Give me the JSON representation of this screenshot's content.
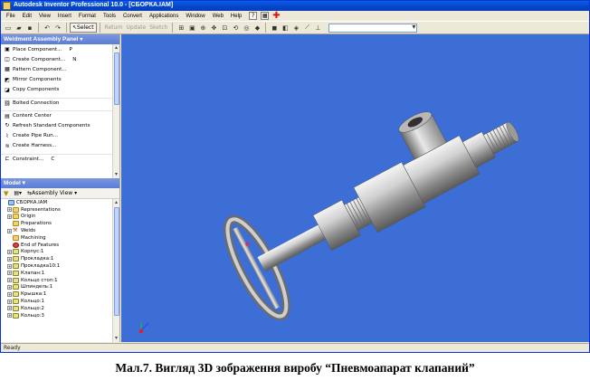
{
  "window": {
    "title": "Autodesk Inventor Professional 10.0 - [СБОРКА.IAM]"
  },
  "menu": [
    "File",
    "Edit",
    "View",
    "Insert",
    "Format",
    "Tools",
    "Convert",
    "Applications",
    "Window",
    "Web",
    "Help"
  ],
  "toolbar": {
    "select_label": "Select",
    "return_label": "Return",
    "update_label": "Update",
    "sketch_label": "Sketch"
  },
  "weldment_panel": {
    "title": "Weldment Assembly Panel",
    "commands": [
      {
        "label": "Place Component...",
        "key": "P"
      },
      {
        "label": "Create Component...",
        "key": "N"
      },
      {
        "label": "Pattern Component...",
        "key": ""
      },
      {
        "label": "Mirror Components",
        "key": ""
      },
      {
        "label": "Copy Components",
        "key": ""
      },
      {
        "label": "Bolted Connection",
        "key": ""
      },
      {
        "label": "Content Center",
        "key": ""
      },
      {
        "label": "Refresh Standard Components",
        "key": ""
      },
      {
        "label": "Create Pipe Run...",
        "key": ""
      },
      {
        "label": "Create Harness...",
        "key": ""
      },
      {
        "label": "Constraint...",
        "key": "C"
      }
    ]
  },
  "model_panel": {
    "title": "Model",
    "view_label": "Assembly View",
    "tree": [
      {
        "label": "СБОРКА.IAM",
        "icon": "asm",
        "indent": 0,
        "expand": ""
      },
      {
        "label": "Representations",
        "icon": "folder",
        "indent": 1,
        "expand": "+"
      },
      {
        "label": "Origin",
        "icon": "folder",
        "indent": 1,
        "expand": "+"
      },
      {
        "label": "Preparations",
        "icon": "folder",
        "indent": 1,
        "expand": ""
      },
      {
        "label": "Welds",
        "icon": "weld",
        "indent": 1,
        "expand": "+"
      },
      {
        "label": "Machining",
        "icon": "folder",
        "indent": 1,
        "expand": ""
      },
      {
        "label": "End of Features",
        "icon": "red",
        "indent": 1,
        "expand": ""
      },
      {
        "label": "Корпус:1",
        "icon": "part",
        "indent": 1,
        "expand": "+"
      },
      {
        "label": "Прокладка:1",
        "icon": "part",
        "indent": 1,
        "expand": "+"
      },
      {
        "label": "Прокладка10:1",
        "icon": "part",
        "indent": 1,
        "expand": "+"
      },
      {
        "label": "Клапан:1",
        "icon": "part",
        "indent": 1,
        "expand": "+"
      },
      {
        "label": "Кольцо стоп:1",
        "icon": "part",
        "indent": 1,
        "expand": "+"
      },
      {
        "label": "Шпиндель:1",
        "icon": "part",
        "indent": 1,
        "expand": "+"
      },
      {
        "label": "Крышка:1",
        "icon": "part",
        "indent": 1,
        "expand": "+"
      },
      {
        "label": "Кольцо:1",
        "icon": "part",
        "indent": 1,
        "expand": "+"
      },
      {
        "label": "Кольцо:2",
        "icon": "part",
        "indent": 1,
        "expand": "+"
      },
      {
        "label": "Кольцо:3",
        "icon": "part",
        "indent": 1,
        "expand": "+"
      }
    ]
  },
  "status": {
    "text": "Ready"
  },
  "caption": "Мал.7. Вигляд 3D зображення виробу “Пневмоапарат клапаний”",
  "colors": {
    "viewport_bg": "#3d6ed5",
    "titlebar": "#0a5ee6",
    "panel_header": "#6a88dc"
  }
}
